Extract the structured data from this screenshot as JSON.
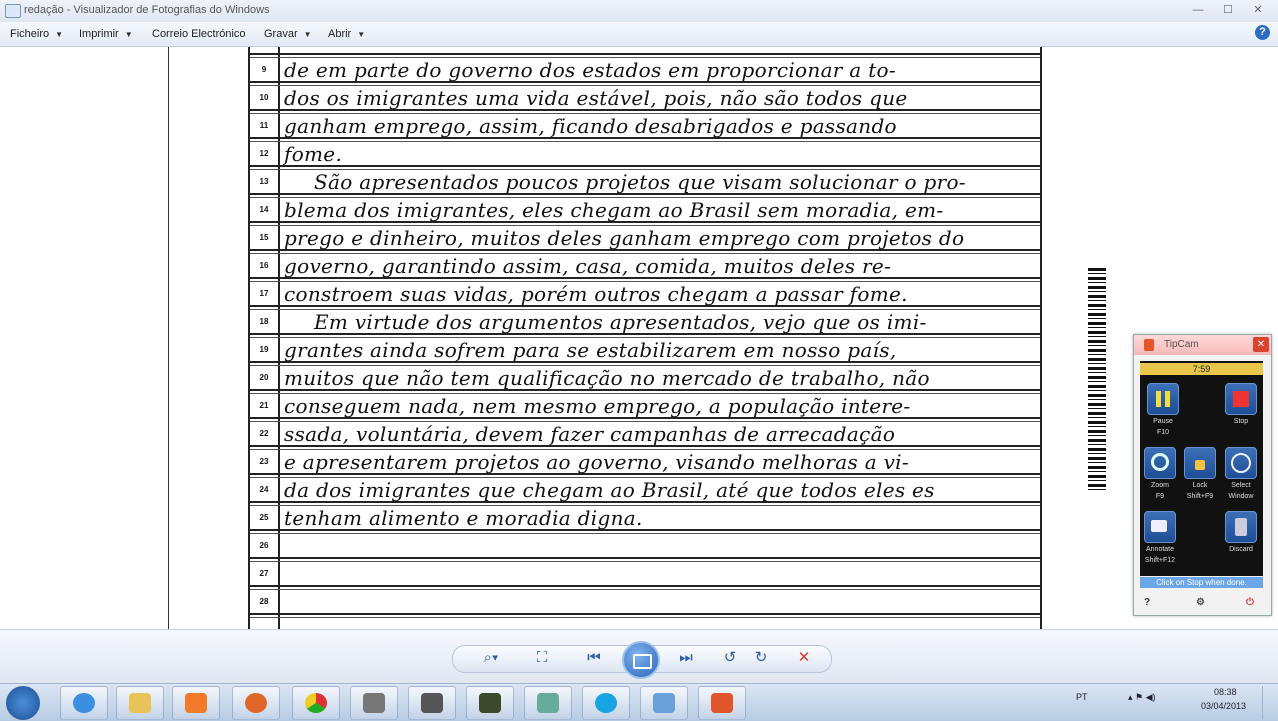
{
  "window": {
    "title": "redação - Visualizador de Fotografias do Windows"
  },
  "window_buttons": {
    "minimize": "—",
    "maximize": "☐",
    "close": "✕"
  },
  "menu": {
    "items": [
      "Ficheiro",
      "Imprimir",
      "Correio Electrónico",
      "Gravar",
      "Abrir"
    ],
    "help": "?"
  },
  "document": {
    "lines": [
      {
        "num": "9",
        "text": "de em parte do governo dos estados em proporcionar a to-"
      },
      {
        "num": "10",
        "text": "dos os imigrantes uma vida estável, pois, não são todos que"
      },
      {
        "num": "11",
        "text": "ganham emprego, assim, ficando desabrigados e passando"
      },
      {
        "num": "12",
        "text": "fome."
      },
      {
        "num": "13",
        "text": "São apresentados poucos projetos que visam solucionar o pro-"
      },
      {
        "num": "14",
        "text": "blema dos imigrantes, eles chegam ao Brasil sem moradia, em-"
      },
      {
        "num": "15",
        "text": "prego e dinheiro, muitos deles ganham emprego com projetos do"
      },
      {
        "num": "16",
        "text": "governo, garantindo assim, casa, comida, muitos deles re-"
      },
      {
        "num": "17",
        "text": "constroem suas vidas, porém outros chegam a passar fome."
      },
      {
        "num": "18",
        "text": "Em virtude dos argumentos apresentados, vejo que os imi-"
      },
      {
        "num": "19",
        "text": "grantes ainda sofrem para se estabilizarem em nosso país,"
      },
      {
        "num": "20",
        "text": "muitos que não tem qualificação no mercado de trabalho, não"
      },
      {
        "num": "21",
        "text": "conseguem nada, nem mesmo emprego, a população intere-"
      },
      {
        "num": "22",
        "text": "ssada, voluntária, devem fazer campanhas de arrecadação"
      },
      {
        "num": "23",
        "text": "e apresentarem projetos ao governo, visando melhoras a vi-"
      },
      {
        "num": "24",
        "text": "da dos imigrantes que chegam ao Brasil, até que todos eles es"
      },
      {
        "num": "25",
        "text": "tenham alimento e moradia digna."
      },
      {
        "num": "26",
        "text": ""
      },
      {
        "num": "27",
        "text": ""
      },
      {
        "num": "28",
        "text": ""
      }
    ]
  },
  "tipcam": {
    "title": "TipCam",
    "timer": "7:59",
    "buttons": [
      {
        "label": "Pause",
        "sub": "F10"
      },
      {
        "label": "Stop",
        "sub": ""
      },
      {
        "label": "Zoom",
        "sub": "F9"
      },
      {
        "label": "Lock",
        "sub": "Shift+F9"
      },
      {
        "label": "Select",
        "sub": "Window"
      },
      {
        "label": "Annotate",
        "sub": "Shift+F12"
      },
      {
        "label": "Discard",
        "sub": ""
      }
    ],
    "hint": "Click on Stop when done.",
    "footer": {
      "help": "?",
      "settings": "⚙",
      "power": "⏻"
    }
  },
  "controls": {
    "zoom": "⌕▾",
    "fit": "⛶",
    "prev": "⏮",
    "next": "⏭",
    "rotate_left": "↺",
    "rotate_right": "↻",
    "delete": "✕"
  },
  "tray": {
    "lang": "PT",
    "time": "08:38",
    "date": "03/04/2013"
  },
  "colors": {
    "accent": "#2d5fa8",
    "delete": "#d23a2a",
    "tipcam_title": "#f7b8b8"
  }
}
